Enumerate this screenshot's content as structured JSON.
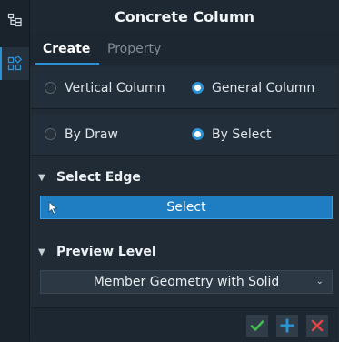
{
  "panel": {
    "title": "Concrete Column"
  },
  "tabs": [
    {
      "label": "Create",
      "active": true
    },
    {
      "label": "Property",
      "active": false
    }
  ],
  "column_type": {
    "options": [
      "Vertical Column",
      "General Column"
    ],
    "selected": "General Column"
  },
  "input_method": {
    "options": [
      "By Draw",
      "By Select"
    ],
    "selected": "By Select"
  },
  "select_edge": {
    "heading": "Select Edge",
    "button_label": "Select"
  },
  "preview_level": {
    "heading": "Preview Level",
    "selected": "Member Geometry with Solid"
  },
  "colors": {
    "accent": "#2c92d6",
    "ok": "#3fbf4f",
    "add": "#2c92d6",
    "cancel": "#e04646"
  },
  "icons": [
    "tree-icon",
    "components-icon",
    "cursor-icon",
    "checkmark-icon",
    "plus-icon",
    "close-icon",
    "chevron-down-icon"
  ]
}
